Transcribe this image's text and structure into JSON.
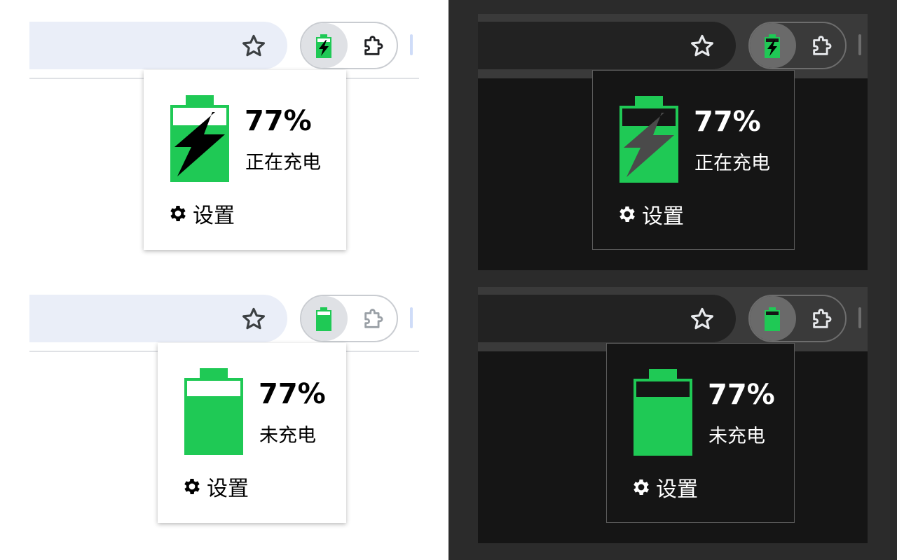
{
  "colors": {
    "battery_green": "#1fc955",
    "light_omnibox": "#eaeef8",
    "dark_frame": "#3a3a3a",
    "dark_popup": "#151515"
  },
  "icons": {
    "bookmark": "star-icon",
    "extension_action": "battery-charging-icon",
    "extensions_menu": "puzzle-icon",
    "settings": "gear-icon"
  },
  "panels": [
    {
      "theme": "light",
      "state": "charging",
      "battery_percent": "77%",
      "battery_level": 0.77,
      "status": "正在充电",
      "settings_label": "设置"
    },
    {
      "theme": "dark",
      "state": "charging",
      "battery_percent": "77%",
      "battery_level": 0.77,
      "status": "正在充电",
      "settings_label": "设置"
    },
    {
      "theme": "light",
      "state": "not-charging",
      "battery_percent": "77%",
      "battery_level": 0.77,
      "status": "未充电",
      "settings_label": "设置"
    },
    {
      "theme": "dark",
      "state": "not-charging",
      "battery_percent": "77%",
      "battery_level": 0.77,
      "status": "未充电",
      "settings_label": "设置"
    }
  ]
}
